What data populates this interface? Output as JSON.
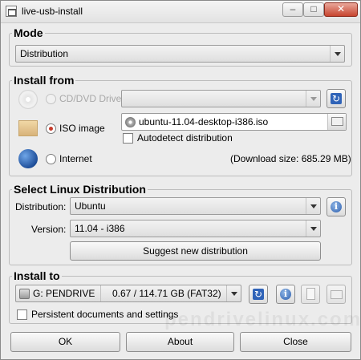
{
  "window": {
    "title": "live-usb-install"
  },
  "mode": {
    "title": "Mode",
    "selected": "Distribution"
  },
  "install_from": {
    "title": "Install from",
    "cd": {
      "label": "CD/DVD Drive",
      "selected": ""
    },
    "iso": {
      "label": "ISO image",
      "file": "ubuntu-11.04-desktop-i386.iso",
      "checked": true
    },
    "autodetect": {
      "label": "Autodetect distribution",
      "checked": false
    },
    "internet": {
      "label": "Internet",
      "download_size": "(Download size: 685.29 MB)"
    }
  },
  "distribution": {
    "title": "Select Linux Distribution",
    "distribution_label": "Distribution:",
    "distribution_value": "Ubuntu",
    "version_label": "Version:",
    "version_value": "11.04 - i386",
    "suggest_label": "Suggest new distribution"
  },
  "install_to": {
    "title": "Install to",
    "drive": "G: PENDRIVE",
    "capacity": "0.67 / 114.71 GB (FAT32)",
    "persistent_label": "Persistent documents and settings",
    "persistent_checked": false
  },
  "footer": {
    "ok": "OK",
    "about": "About",
    "close": "Close"
  },
  "watermark": "pendrivelinux.com",
  "colors": {
    "radio_selected": "#c63b2b",
    "info_blue": "#2d5fae"
  }
}
